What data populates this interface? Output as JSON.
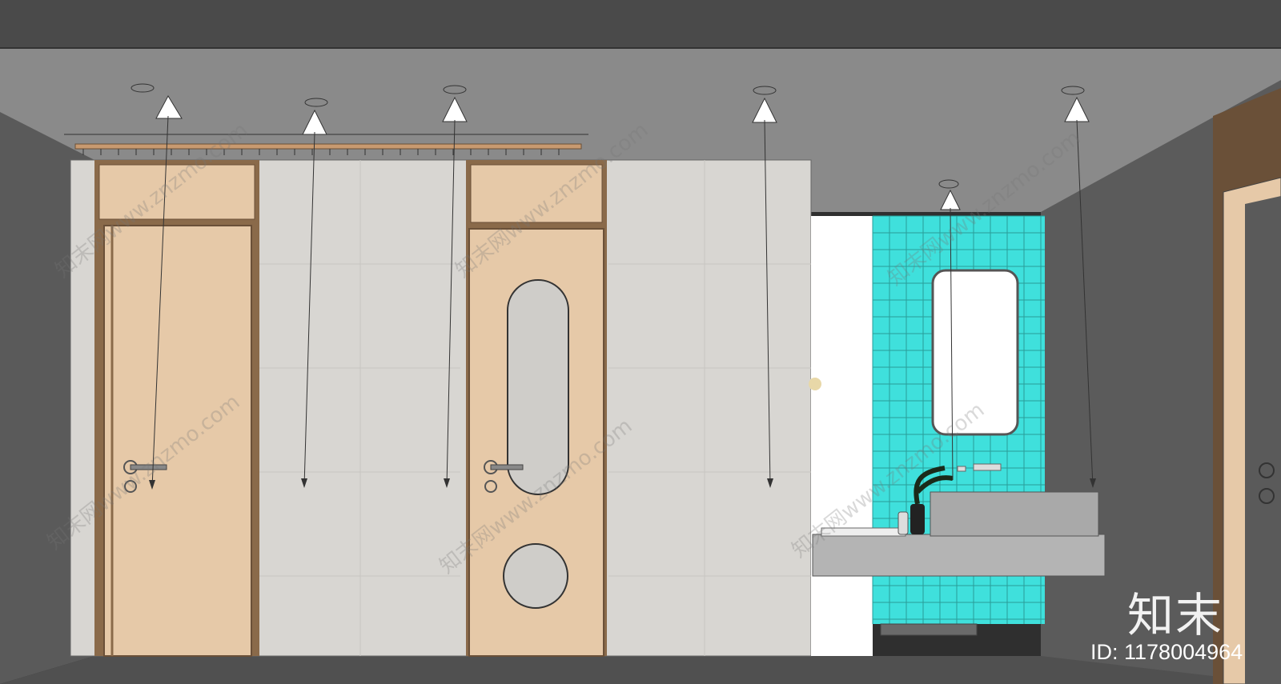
{
  "watermark": {
    "text": "知末网www.znzmo.com"
  },
  "brand": {
    "logo_text": "知末",
    "id_label": "ID: 1178004964"
  },
  "colors": {
    "ceiling": "#8a8a8a",
    "top_band": "#4a4a4a",
    "dark_wall": "#585858",
    "light_wall": "#d8d6d2",
    "wood": "#e6c9a8",
    "tile": "#3fe0dc",
    "terrazzo": "#b4b4b4",
    "floor": "#505050"
  }
}
